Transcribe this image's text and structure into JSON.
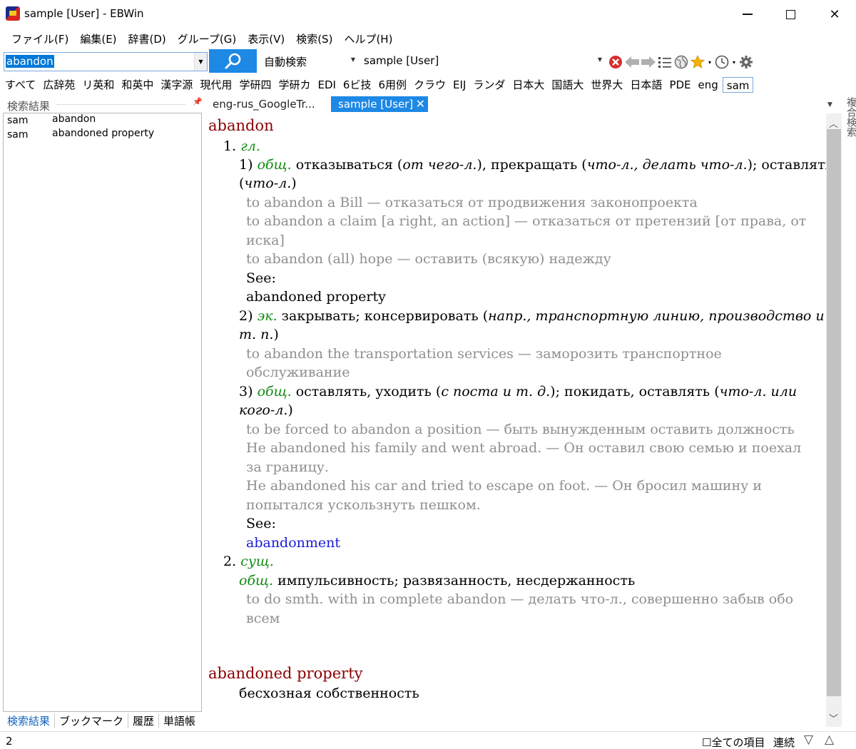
{
  "window": {
    "title": "sample [User] - EBWin"
  },
  "menu": [
    "ファイル(F)",
    "編集(E)",
    "辞書(D)",
    "グループ(G)",
    "表示(V)",
    "検索(S)",
    "ヘルプ(H)"
  ],
  "search": {
    "value": "abandon",
    "mode": "自動検索",
    "dictionary": "sample [User]"
  },
  "groups": [
    "すべて",
    "広辞苑",
    "リ英和",
    "和英中",
    "漢字源",
    "現代用",
    "学研四",
    "学研カ",
    "EDI",
    "6ビ技",
    "6用例",
    "クラウ",
    "EIJ",
    "ランダ",
    "日本大",
    "国語大",
    "世界大",
    "日本語",
    "PDE",
    "eng",
    "sam"
  ],
  "results": {
    "title": "検索結果",
    "rows": [
      {
        "dict": "sam",
        "word": "abandon"
      },
      {
        "dict": "sam",
        "word": "abandoned property"
      }
    ]
  },
  "left_tabs": [
    "検索結果",
    "ブックマーク",
    "履歴",
    "単語帳"
  ],
  "tabs": [
    "eng-rus_GoogleTr...",
    "sample [User]"
  ],
  "side_label": "複合検索",
  "entry": {
    "headword1": "abandon",
    "n1": "1.",
    "pos1": "гл.",
    "s1_num": "1)",
    "s1_dom": "общ.",
    "s1_a": "отказываться (",
    "s1_b": "от чего-л.",
    "s1_c": "), прекращать (",
    "s1_d": "что-л., делать что-л.",
    "s1_e": "); оставлять",
    "s1_f": "(",
    "s1_g": "что-л.",
    "s1_h": ")",
    "ex1": "to abandon a Bill — отказаться от продвижения законопроекта",
    "ex2a": "to abandon a claim [a right, an action] — отказаться от претензий [от права, от",
    "ex2b": "иска]",
    "ex3": "to abandon (all) hope — оставить (всякую) надежду",
    "see1": "See:",
    "see1_val": "abandoned property",
    "s2_num": "2)",
    "s2_dom": "эк.",
    "s2_a": "закрывать; консервировать (",
    "s2_b": "напр., транспортную линию, производство и",
    "s2_c": "т. п.",
    "s2_d": ")",
    "ex4a": "to abandon the transportation services — заморозить транспортное",
    "ex4b": "обслуживание",
    "s3_num": "3)",
    "s3_dom": "общ.",
    "s3_a": "оставлять, уходить (",
    "s3_b": "с поста и т. д.",
    "s3_c": "); покидать, оставлять (",
    "s3_d": "что-л. или",
    "s3_e": "кого-л.",
    "s3_f": ")",
    "ex5": "to be forced to abandon a position — быть вынужденным оставить должность",
    "ex6a": "He abandoned his family and went abroad. — Он оставил свою семью и поехал",
    "ex6b": "за границу.",
    "ex7a": "He abandoned his car and tried to escape on foot. — Он бросил машину и",
    "ex7b": "попытался ускользнуть пешком.",
    "see2": "See:",
    "see2_val": "abandonment",
    "n2": "2.",
    "pos2": "сущ.",
    "s4_dom": "общ.",
    "s4_a": "импульсивность; развязанность, несдержанность",
    "ex8a": "to do smth. with in complete abandon — делать что-л., совершенно забыв обо",
    "ex8b": "всем",
    "headword2": "abandoned property",
    "def2": "бесхозная собственность"
  },
  "status": {
    "count": "2",
    "all_items": "全ての項目",
    "continuous": "連続"
  },
  "colors": {
    "headword": "#8b0000",
    "domain": "#138a13",
    "example": "#8f8f8f",
    "link": "#1a1ad8",
    "accent": "#1e88e5"
  }
}
